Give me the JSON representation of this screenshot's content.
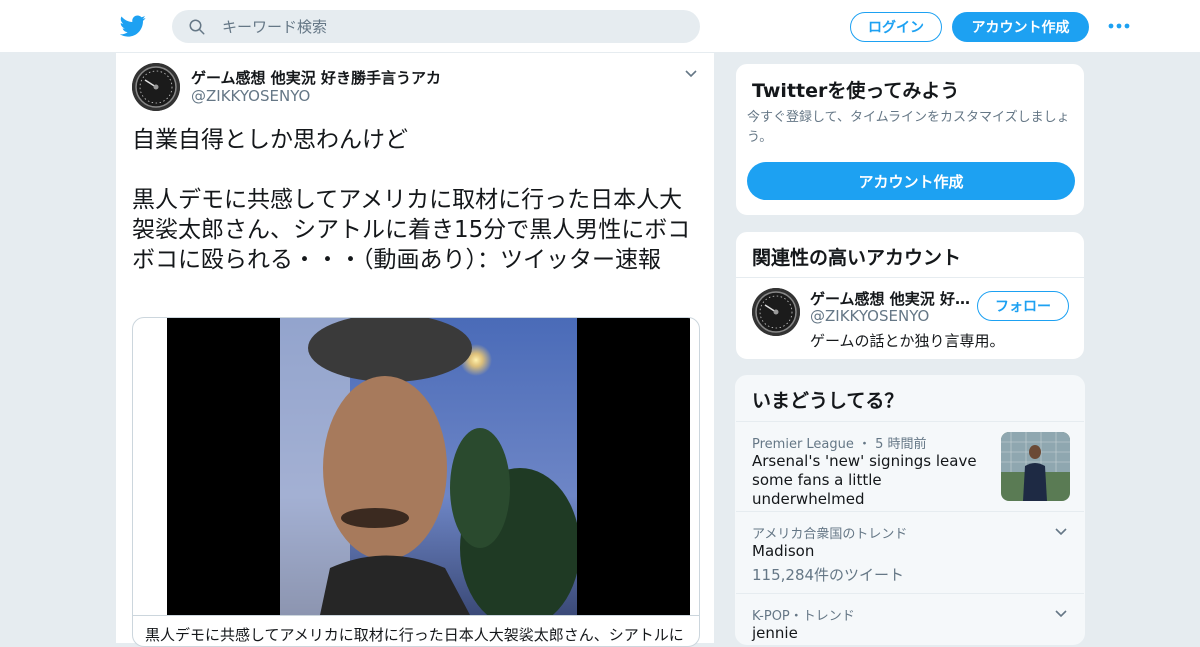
{
  "header": {
    "search_placeholder": "キーワード検索",
    "login_label": "ログイン",
    "signup_label": "アカウント作成"
  },
  "tweet": {
    "author_name": "ゲーム感想 他実況 好き勝手言うアカ",
    "author_handle": "@ZIKKYOSENYO",
    "text": "自業自得としか思わんけど\n\n黒人デモに共感してアメリカに取材に行った日本人大袈裟太郎さん、シアトルに着き15分で黒人男性にボコボコに殴られる・・・（動画あり）：ツイッター速報",
    "media_caption": "黒人デモに共感してアメリカに取材に行った日本人大袈裟太郎さん、シアトルに"
  },
  "signup_card": {
    "title": "Twitterを使ってみよう",
    "description": "今すぐ登録して、タイムラインをカスタマイズしましょう。",
    "button_label": "アカウント作成"
  },
  "related_card": {
    "title": "関連性の高いアカウント",
    "account_name": "ゲーム感想 他実況 好き勝手言うアカ",
    "account_handle": "@ZIKKYOSENYO",
    "account_bio": "ゲームの話とか独り言専用。",
    "follow_label": "フォロー"
  },
  "trends": {
    "title": "いまどうしてる？",
    "items": [
      {
        "meta": "Premier League ・ 5 時間前",
        "title": "Arsenal's 'new' signings leave some fans a little underwhelmed"
      },
      {
        "meta": "アメリカ合衆国のトレンド",
        "title": "Madison",
        "count": "115,284件のツイート"
      },
      {
        "meta": "K-POP・トレンド",
        "title": "jennie"
      }
    ]
  },
  "colors": {
    "accent": "#1da1f2",
    "text_primary": "#14171a",
    "text_secondary": "#657786",
    "page_background": "#e6ecf0"
  }
}
